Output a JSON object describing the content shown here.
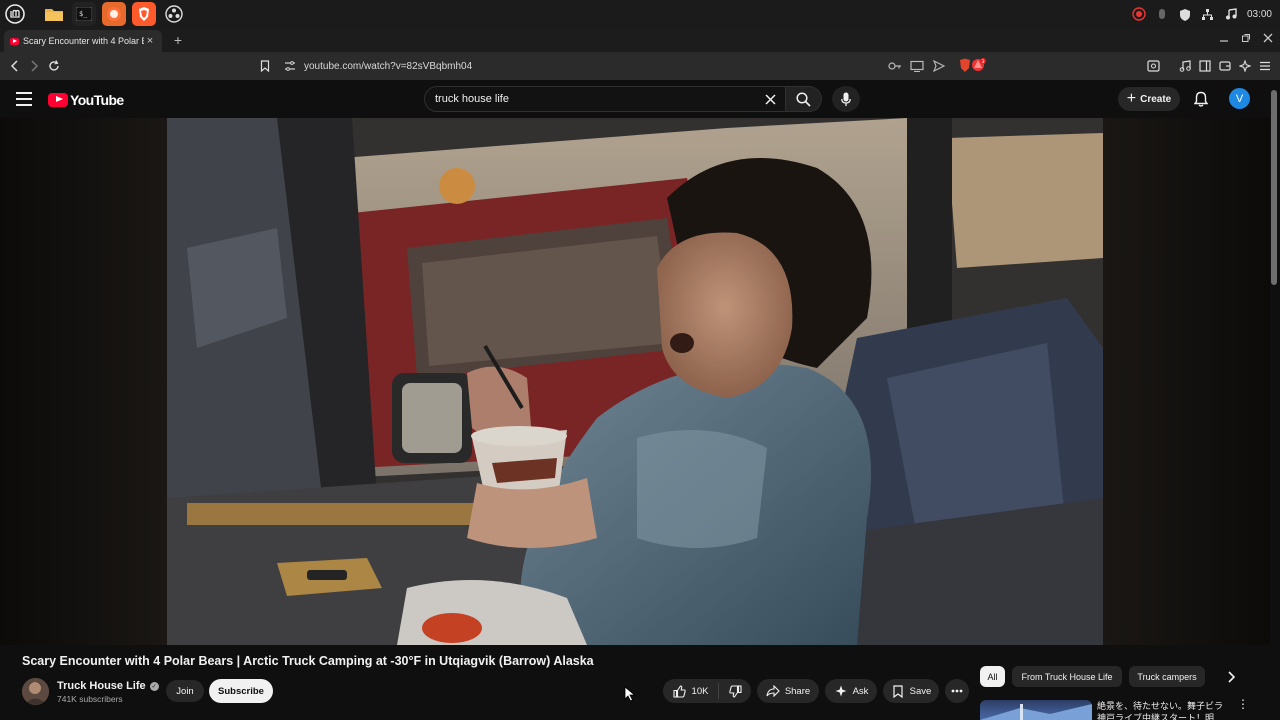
{
  "os": {
    "clock": "03:00"
  },
  "browser": {
    "tab_title": "Scary Encounter with 4 Polar Bears | Arctic Truck Camping at -30°F in Utqiagvik (Barrow) Alaska",
    "tab_close": "×",
    "new_tab": "+",
    "url": "youtube.com/watch?v=82sVBqbmh04",
    "shield_badge": "3"
  },
  "youtube": {
    "logo_text": "YouTube",
    "search": {
      "value": "truck house life"
    },
    "create_label": "Create",
    "avatar_letter": "V"
  },
  "video": {
    "title": "Scary Encounter with 4 Polar Bears | Arctic Truck Camping at -30°F in Utqiagvik (Barrow) Alaska",
    "channel": {
      "name": "Truck House Life",
      "subscribers": "741K subscribers"
    },
    "join_label": "Join",
    "subscribe_label": "Subscribe",
    "actions": {
      "likes": "10K",
      "share_label": "Share",
      "ask_label": "Ask",
      "save_label": "Save"
    }
  },
  "chips": [
    "All",
    "From Truck House Life",
    "Truck campers"
  ],
  "related": {
    "title": "絶景を、待たせない。舞子ビラ 神戸ライブ中継スタート！明"
  },
  "colors": {
    "yt_red": "#ff0033",
    "background": "#0f0f0f",
    "avatar_blue": "#1e88e5"
  }
}
